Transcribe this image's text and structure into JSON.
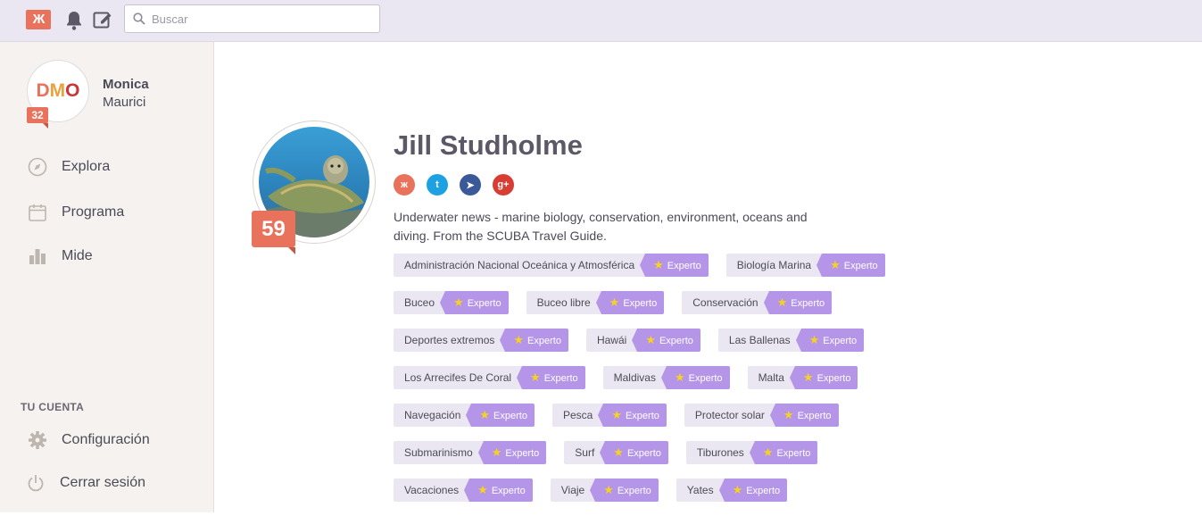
{
  "topbar": {
    "logo_text": "Ж",
    "search_placeholder": "Buscar"
  },
  "user": {
    "initials": [
      "D",
      "M",
      "O"
    ],
    "score": "32",
    "first_name": "Monica",
    "last_name": "Maurici"
  },
  "nav": {
    "explore": "Explora",
    "schedule": "Programa",
    "measure": "Mide",
    "account_section": "TU CUENTA",
    "settings": "Configuración",
    "logout": "Cerrar sesión"
  },
  "profile": {
    "score": "59",
    "name": "Jill Studholme",
    "bio": "Underwater news - marine biology, conservation, environment, oceans and diving. From the SCUBA Travel Guide.",
    "socials": [
      {
        "name": "klout",
        "glyph": "ж",
        "color": "#e8725c"
      },
      {
        "name": "twitter",
        "glyph": "t",
        "color": "#1da1e2"
      },
      {
        "name": "foursquare",
        "glyph": "➤",
        "color": "#3b5998"
      },
      {
        "name": "google-plus",
        "glyph": "g+",
        "color": "#d73d32"
      }
    ],
    "expert_label": "Experto",
    "tag_rows": [
      [
        "Administración Nacional Oceánica y Atmosférica",
        "Biología Marina"
      ],
      [
        "Buceo",
        "Buceo libre",
        "Conservación"
      ],
      [
        "Deportes extremos",
        "Hawái",
        "Las Ballenas"
      ],
      [
        "Los Arrecifes De Coral",
        "Maldivas",
        "Malta"
      ],
      [
        "Navegación",
        "Pesca",
        "Protector solar"
      ],
      [
        "Submarinismo",
        "Surf",
        "Tiburones"
      ],
      [
        "Vacaciones",
        "Viaje",
        "Yates"
      ]
    ]
  }
}
